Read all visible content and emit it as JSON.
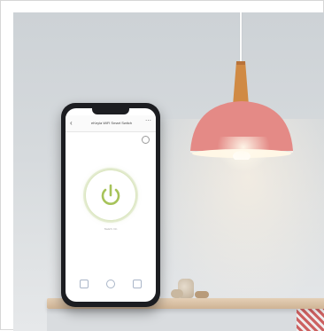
{
  "image": {
    "description_tags": [
      "pendant-lamp",
      "smartphone",
      "wooden-shelf",
      "decor-objects"
    ]
  },
  "phone_app": {
    "header_title": "eKeyla WiFi Smart Switch",
    "back_icon": "chevron-left-icon",
    "more_icon": "more-dots-icon",
    "settings_icon": "settings-icon",
    "power_icon": "power-icon",
    "power_status": "Switch: On",
    "nav_icons": [
      "timer-icon",
      "countdown-icon",
      "schedule-icon"
    ]
  },
  "colors": {
    "lamp_shade": "#e48a86",
    "lamp_neck": "#d08a44",
    "power_ring": "#a7c35a",
    "wall": "#d6dadd",
    "shelf": "#dcc3a6"
  }
}
